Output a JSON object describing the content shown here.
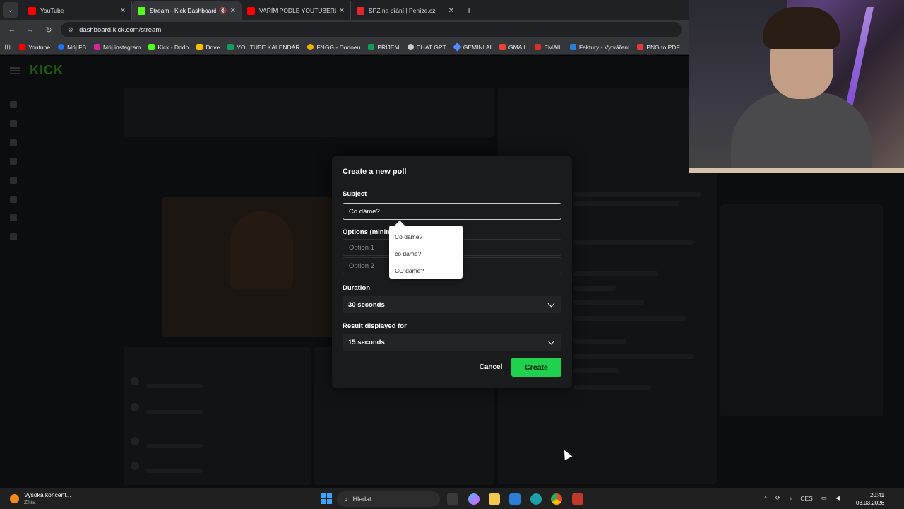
{
  "browser": {
    "tabs": [
      {
        "title": "YouTube",
        "color": "#ff0000",
        "active": false
      },
      {
        "title": "Stream - Kick Dashboard",
        "color": "#53fc18",
        "active": true
      },
      {
        "title": "VAŘÍM PODLE YOUTUBERŮ - Yo",
        "color": "#ff0000",
        "active": false
      },
      {
        "title": "SPZ na přání | Peníze.cz",
        "color": "#e1262c",
        "active": false
      }
    ],
    "url": "dashboard.kick.com/stream",
    "bookmarks": [
      {
        "label": "Youtube",
        "color": "#ff0000"
      },
      {
        "label": "Můj FB",
        "color": "#1877f2"
      },
      {
        "label": "Můj instagram",
        "color": "#d6249f"
      },
      {
        "label": "Kick - Dodo",
        "color": "#53fc18"
      },
      {
        "label": "Drive",
        "color": "#fbbc04"
      },
      {
        "label": "YOUTUBE KALENDÁŘ",
        "color": "#0f9d58"
      },
      {
        "label": "FNGG - Dodoeu",
        "color": "#f4b400"
      },
      {
        "label": "PŘÍJEM",
        "color": "#0f9d58"
      },
      {
        "label": "CHAT GPT",
        "color": "#cccccc"
      },
      {
        "label": "GEMINI AI",
        "color": "#4f8cff"
      },
      {
        "label": "GMAIL",
        "color": "#ea4335"
      },
      {
        "label": "EMAIL",
        "color": "#d93025"
      },
      {
        "label": "Faktury - Vytváření",
        "color": "#2a7fd4"
      },
      {
        "label": "PNG to PDF",
        "color": "#e53935"
      }
    ]
  },
  "modal": {
    "title": "Create a new poll",
    "subject_label": "Subject",
    "subject_value": "Co dáme?",
    "options_label": "Options (minim",
    "option1_placeholder": "Option 1",
    "option2_placeholder": "Option 2",
    "duration_label": "Duration",
    "duration_value": "30 seconds",
    "result_label": "Result displayed for",
    "result_value": "15 seconds",
    "cancel_label": "Cancel",
    "create_label": "Create"
  },
  "autocomplete": [
    "Co dáme?",
    "co dáme?",
    "CO dáme?"
  ],
  "taskbar": {
    "weather_title": "Vysoká koncent...",
    "weather_sub": "Zítra",
    "search_placeholder": "Hledat",
    "lang": "CES",
    "time": "20:41",
    "date": "03.03.2026"
  },
  "colors": {
    "accent": "#1fd14d",
    "modal_bg": "#191b1c"
  }
}
